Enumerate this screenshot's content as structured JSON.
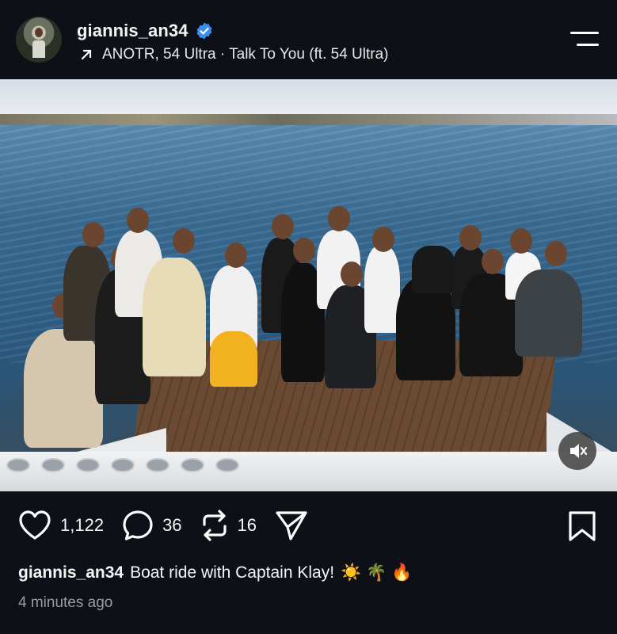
{
  "header": {
    "username": "giannis_an34",
    "music": "ANOTR, 54 Ultra · Talk To You (ft. 54 Ultra)"
  },
  "actions": {
    "likes": "1,122",
    "comments": "36",
    "reposts": "16"
  },
  "caption": {
    "username": "giannis_an34",
    "text": "Boat ride with Captain Klay!",
    "emojis": "☀️ 🌴 🔥"
  },
  "timestamp": "4 minutes ago",
  "colors": {
    "background": "#0d1016",
    "verified": "#3b8ff0",
    "text": "#f5f5f5",
    "muted": "#9a9ca1"
  }
}
